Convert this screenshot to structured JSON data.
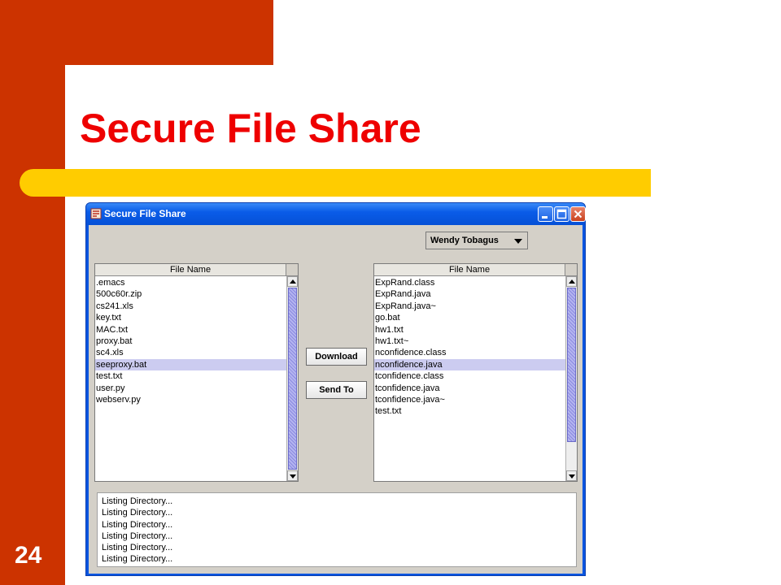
{
  "slide": {
    "title": "Secure File Share",
    "number": "24"
  },
  "window": {
    "title": "Secure File Share",
    "controls": [
      "minimize",
      "maximize",
      "close"
    ]
  },
  "user_select": {
    "value": "Wendy Tobagus"
  },
  "local_files": {
    "header": "File Name",
    "items": [
      ".emacs",
      "500c60r.zip",
      "cs241.xls",
      "key.txt",
      "MAC.txt",
      "proxy.bat",
      "sc4.xls",
      "seeproxy.bat",
      "test.txt",
      "user.py",
      "webserv.py"
    ],
    "selected_index": 7,
    "scroll_position": 0,
    "visible_fraction": 1.0
  },
  "remote_files": {
    "header": "File Name",
    "items": [
      "ExpRand.class",
      "ExpRand.java",
      "ExpRand.java~",
      "go.bat",
      "hw1.txt",
      "hw1.txt~",
      "nconfidence.class",
      "nconfidence.java",
      "tconfidence.class",
      "tconfidence.java",
      "tconfidence.java~",
      "test.txt"
    ],
    "selected_index": 7,
    "scroll_position": 0,
    "visible_fraction": 0.85
  },
  "buttons": {
    "download": "Download",
    "send_to": "Send To"
  },
  "log": [
    "Listing Directory...",
    "Listing Directory...",
    "Listing Directory...",
    "Listing Directory...",
    "Listing Directory...",
    "Listing Directory..."
  ],
  "colors": {
    "slide_red": "#cc3300",
    "slide_yellow": "#ffcc00",
    "title_red": "#ee0000",
    "selection": "#ccccf0"
  },
  "icons": {
    "app": "app-icon",
    "minimize": "minimize-icon",
    "maximize": "maximize-icon",
    "close": "close-icon",
    "dropdown": "chevron-down-icon"
  }
}
